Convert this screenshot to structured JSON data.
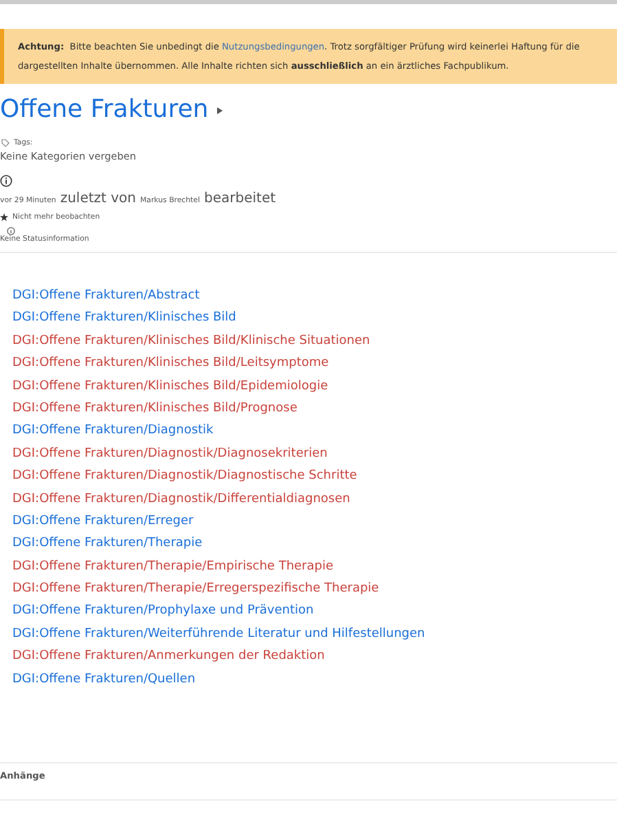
{
  "notice": {
    "label": "Achtung:",
    "text": "Bitte beachten Sie unbedingt die",
    "link": "Nutzungsbedingungen",
    "rest": ". Trotz sorgfältiger Prüfung wird keinerlei Haftung für die dargestellten Inhalte übernommen. Alle Inhalte richten sich **ausschließlich** an ein ärztliches Fachpublikum."
  },
  "title": "Offene Frakturen",
  "tags": {
    "label": "Tags:",
    "value": "Keine Kategorien vergeben"
  },
  "edited": {
    "time": "vor 29 Minuten",
    "phrase": "zuletzt von",
    "author": "Markus Brechtel",
    "action": "bearbeitet"
  },
  "watch": "Nicht mehr beobachten",
  "status": "Keine Statusinformation",
  "links": [
    {
      "text": "DGI:Offene Frakturen/Abstract",
      "exists": true
    },
    {
      "text": "DGI:Offene Frakturen/Klinisches Bild",
      "exists": true
    },
    {
      "text": "DGI:Offene Frakturen/Klinisches Bild/Klinische Situationen",
      "exists": false
    },
    {
      "text": "DGI:Offene Frakturen/Klinisches Bild/Leitsymptome",
      "exists": false
    },
    {
      "text": "DGI:Offene Frakturen/Klinisches Bild/Epidemiologie",
      "exists": false
    },
    {
      "text": "DGI:Offene Frakturen/Klinisches Bild/Prognose",
      "exists": false
    },
    {
      "text": "DGI:Offene Frakturen/Diagnostik",
      "exists": true
    },
    {
      "text": "DGI:Offene Frakturen/Diagnostik/Diagnosekriterien",
      "exists": false
    },
    {
      "text": "DGI:Offene Frakturen/Diagnostik/Diagnostische Schritte",
      "exists": false
    },
    {
      "text": "DGI:Offene Frakturen/Diagnostik/Differentialdiagnosen",
      "exists": false
    },
    {
      "text": "DGI:Offene Frakturen/Erreger",
      "exists": true
    },
    {
      "text": "DGI:Offene Frakturen/Therapie",
      "exists": true
    },
    {
      "text": "DGI:Offene Frakturen/Therapie/Empirische Therapie",
      "exists": false
    },
    {
      "text": "DGI:Offene Frakturen/Therapie/Erregerspezifische Therapie",
      "exists": false
    },
    {
      "text": "DGI:Offene Frakturen/Prophylaxe und Prävention",
      "exists": true
    },
    {
      "text": "DGI:Offene Frakturen/Weiterführende Literatur und Hilfestellungen",
      "exists": true
    },
    {
      "text": "DGI:Offene Frakturen/Anmerkungen der Redaktion",
      "exists": false
    },
    {
      "text": "DGI:Offene Frakturen/Quellen",
      "exists": true
    }
  ],
  "attachments": "Anhänge"
}
